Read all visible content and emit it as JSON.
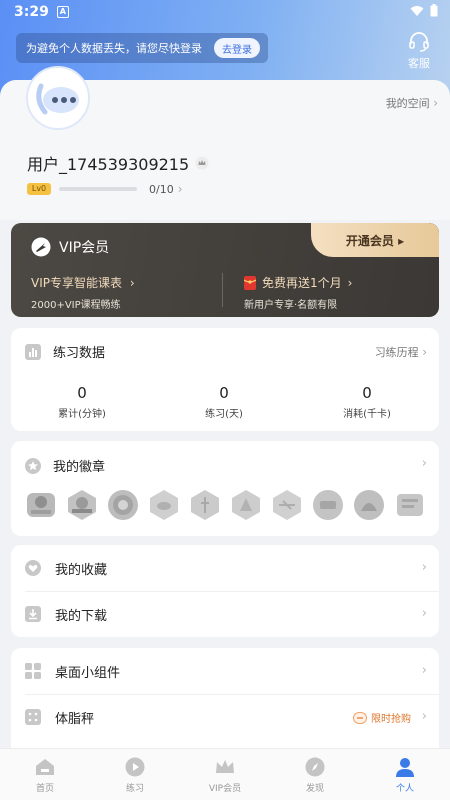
{
  "status_bar": {
    "time": "3:29",
    "notification_glyph": "A"
  },
  "login_banner": {
    "text": "为避免个人数据丢失，请您尽快登录",
    "button": "去登录"
  },
  "service": {
    "label": "客服",
    "icon": "headset-icon"
  },
  "profile": {
    "my_space": "我的空间",
    "username": "用户_174539309215",
    "level": "Lv0",
    "level_progress_text": "0/10",
    "level_progress": 0.0
  },
  "vip": {
    "title": "VIP会员",
    "open_button": "开通会员 ▸",
    "left_title": "VIP专享智能课表",
    "left_sub": "2000+VIP课程畅练",
    "right_title": "免费再送1个月",
    "right_sub": "新用户专享·名额有限"
  },
  "practice": {
    "title": "练习数据",
    "link": "习练历程",
    "stats": [
      {
        "value": "0",
        "label": "累计(分钟)"
      },
      {
        "value": "0",
        "label": "练习(天)"
      },
      {
        "value": "0",
        "label": "消耗(千卡)"
      }
    ]
  },
  "badges": {
    "title": "我的徽章",
    "count": 10
  },
  "favorites": {
    "items": [
      {
        "label": "我的收藏"
      },
      {
        "label": "我的下载"
      }
    ]
  },
  "tools": {
    "items": [
      {
        "label": "桌面小组件",
        "extra": ""
      },
      {
        "label": "体脂秤",
        "extra": "限时抢购"
      }
    ]
  },
  "tabbar": {
    "tabs": [
      {
        "label": "首页",
        "icon": "home-icon"
      },
      {
        "label": "练习",
        "icon": "play-icon"
      },
      {
        "label": "VIP会员",
        "icon": "crown-icon"
      },
      {
        "label": "发现",
        "icon": "compass-icon"
      },
      {
        "label": "个人",
        "icon": "person-icon"
      }
    ],
    "active_index": 4
  },
  "colors": {
    "accent": "#3a7be8",
    "vip_gold": "#e7c999",
    "vip_dark": "#3f3c38"
  }
}
